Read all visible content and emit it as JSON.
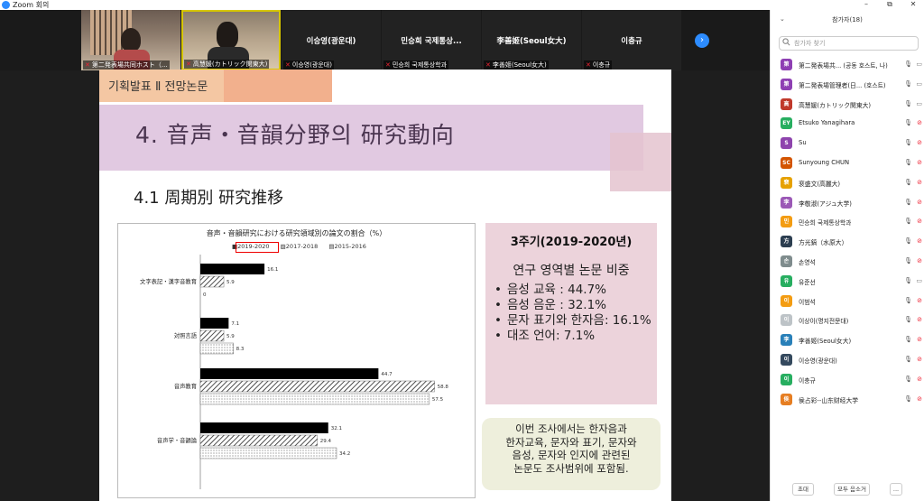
{
  "window": {
    "title": "Zoom 회의",
    "minimize": "–",
    "restore": "⧉",
    "close": "✕"
  },
  "video_strip": {
    "tiles": [
      {
        "caption": "第二発表場共同ホスト（...",
        "type": "video"
      },
      {
        "caption": "高慧媛(カトリック関東大)",
        "type": "video"
      },
      {
        "name": "이승영(광운대)",
        "caption": "이승영(광운대)"
      },
      {
        "name": "민승희 국제통상...",
        "caption": "민승희 국제통상학과"
      },
      {
        "name": "李善姬(Seoul女大)",
        "caption": "李善姬(Seoul女大)"
      },
      {
        "name": "이충규",
        "caption": "이충규"
      }
    ],
    "next_arrow": "›"
  },
  "slide": {
    "header": "기획발표 Ⅱ 전망논문",
    "section_title": "4.  音声・音韻分野의  研究動向",
    "subtitle": "4.1  周期別  研究推移",
    "right_box": {
      "heading": "3주기(2019-2020년)",
      "subheading": "연구 영역별 논문 비중",
      "items": [
        "음성 교육 :  44.7%",
        "음성 음운 :  32.1%",
        "문자 표기와 한자음: 16.1%",
        "대조 언어: 7.1%"
      ]
    },
    "note_box": {
      "lines": [
        "이번 조사에서는 한자음과",
        "한자교육, 문자와 표기, 문자와",
        "음성, 문자와 인지에 관련된",
        "논문도 조사범위에 포함됨."
      ]
    }
  },
  "chart_data": {
    "type": "bar",
    "orientation": "horizontal",
    "title": "音声・音韻研究における研究領域別の論文の割合（%）",
    "categories": [
      "文字表記・漢字音教育",
      "対照言語",
      "音声教育",
      "音声学・音韻論"
    ],
    "series": [
      {
        "name": "2019-2020",
        "values": [
          16.1,
          7.1,
          44.7,
          32.1
        ],
        "fill": "solid-black"
      },
      {
        "name": "2017-2018",
        "values": [
          5.9,
          5.9,
          58.8,
          29.4
        ],
        "fill": "diagonal-hatch"
      },
      {
        "name": "2015-2016",
        "values": [
          0,
          8.3,
          57.5,
          34.2
        ],
        "fill": "dotted"
      }
    ],
    "legend_labels": [
      "■2019-2020",
      "▨2017-2018",
      "▤2015-2016"
    ],
    "xlim": [
      0,
      65
    ],
    "legend_position": "top-center",
    "highlighted_series": "2019-2020",
    "data_labels": true
  },
  "participants": {
    "header": "참가자(18)",
    "search_placeholder": "참가자 찾기",
    "list": [
      {
        "initial": "第",
        "name": "第二発表場共... (공동 호스트, 나)",
        "color": "#8e3fb3",
        "video": true
      },
      {
        "initial": "第",
        "name": "第二発表場管理者(日... (호스트)",
        "color": "#8e3fb3",
        "video": true
      },
      {
        "initial": "高",
        "name": "高慧媛(カトリック関東大)",
        "color": "#c0392b",
        "video": true
      },
      {
        "initial": "EY",
        "name": "Etsuko Yanagihara",
        "color": "#27ae60",
        "video": false
      },
      {
        "initial": "S",
        "name": "Su",
        "color": "#8e44ad",
        "video": false
      },
      {
        "initial": "SC",
        "name": "Sunyoung CHUN",
        "color": "#d35400",
        "video": false
      },
      {
        "initial": "裵",
        "name": "裵盛文(高麗大)",
        "color": "#e6a100",
        "video": false
      },
      {
        "initial": "李",
        "name": "李敬淑(アジュ大学)",
        "color": "#9b59b6",
        "video": false
      },
      {
        "initial": "민",
        "name": "민승희 국제통상학과",
        "color": "#f39c12",
        "video": false
      },
      {
        "initial": "方",
        "name": "方光鎬（水原大）",
        "color": "#2c3e50",
        "video": false
      },
      {
        "initial": "손",
        "name": "손영석",
        "color": "#7f8c8d",
        "video": false
      },
      {
        "initial": "유",
        "name": "유준선",
        "color": "#27ae60",
        "video": true
      },
      {
        "initial": "이",
        "name": "이범석",
        "color": "#f39c12",
        "video": false
      },
      {
        "initial": "이",
        "name": "이상이(명지전문대)",
        "color": "#bdc3c7",
        "video": false
      },
      {
        "initial": "李",
        "name": "李善姬(Seoul女大)",
        "color": "#2980b9",
        "video": false
      },
      {
        "initial": "이",
        "name": "이승영(광운대)",
        "color": "#34495e",
        "video": false
      },
      {
        "initial": "이",
        "name": "이충규",
        "color": "#27ae60",
        "video": false
      },
      {
        "initial": "侯",
        "name": "侯占彩--山东财经大学",
        "color": "#e67e22",
        "video": false
      }
    ],
    "buttons": {
      "invite": "초대",
      "mute_all": "모두 음소거",
      "more": "..."
    }
  }
}
